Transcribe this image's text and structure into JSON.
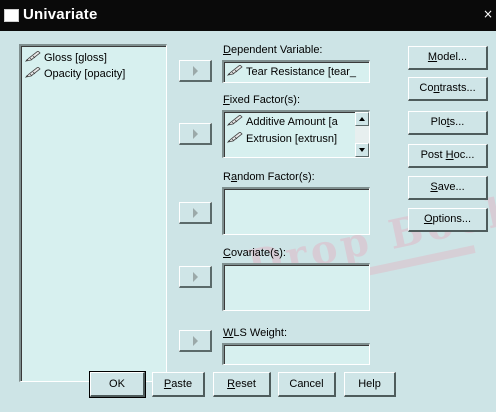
{
  "window": {
    "title": "Univariate",
    "close_glyph": "×"
  },
  "variable_list": {
    "items": [
      {
        "label": "Gloss [gloss]",
        "icon": "ruler-pencil-icon"
      },
      {
        "label": "Opacity [opacity]",
        "icon": "ruler-pencil-icon"
      }
    ]
  },
  "dependent": {
    "label_pre": "",
    "label_acc": "D",
    "label_post": "ependent Variable:",
    "value": "Tear Resistance [tear_"
  },
  "fixed": {
    "label_pre": "",
    "label_acc": "F",
    "label_post": "ixed Factor(s):",
    "items": [
      "Additive Amount [a",
      "Extrusion [extrusn]"
    ]
  },
  "random": {
    "label_pre": "R",
    "label_acc": "a",
    "label_post": "ndom Factor(s):"
  },
  "covariate": {
    "label_pre": "",
    "label_acc": "C",
    "label_post": "ovariate(s):"
  },
  "wls": {
    "label_pre": "",
    "label_acc": "W",
    "label_post": "LS Weight:"
  },
  "side_buttons": [
    {
      "pre": "",
      "acc": "M",
      "post": "odel..."
    },
    {
      "pre": "Co",
      "acc": "n",
      "post": "trasts..."
    },
    {
      "pre": "Plo",
      "acc": "t",
      "post": "s..."
    },
    {
      "pre": "Post ",
      "acc": "H",
      "post": "oc..."
    },
    {
      "pre": "",
      "acc": "S",
      "post": "ave..."
    },
    {
      "pre": "",
      "acc": "O",
      "post": "ptions..."
    }
  ],
  "bottom_buttons": [
    {
      "pre": "OK",
      "acc": "",
      "post": ""
    },
    {
      "pre": "",
      "acc": "P",
      "post": "aste"
    },
    {
      "pre": "",
      "acc": "R",
      "post": "eset"
    },
    {
      "pre": "Cancel",
      "acc": "",
      "post": ""
    },
    {
      "pre": "Help",
      "acc": "",
      "post": ""
    }
  ],
  "watermark": "Drop Book",
  "colors": {
    "titlebar": "#0a0a0a",
    "dialog_bg": "#cde4e6",
    "field_bg": "#d7f0ef"
  }
}
